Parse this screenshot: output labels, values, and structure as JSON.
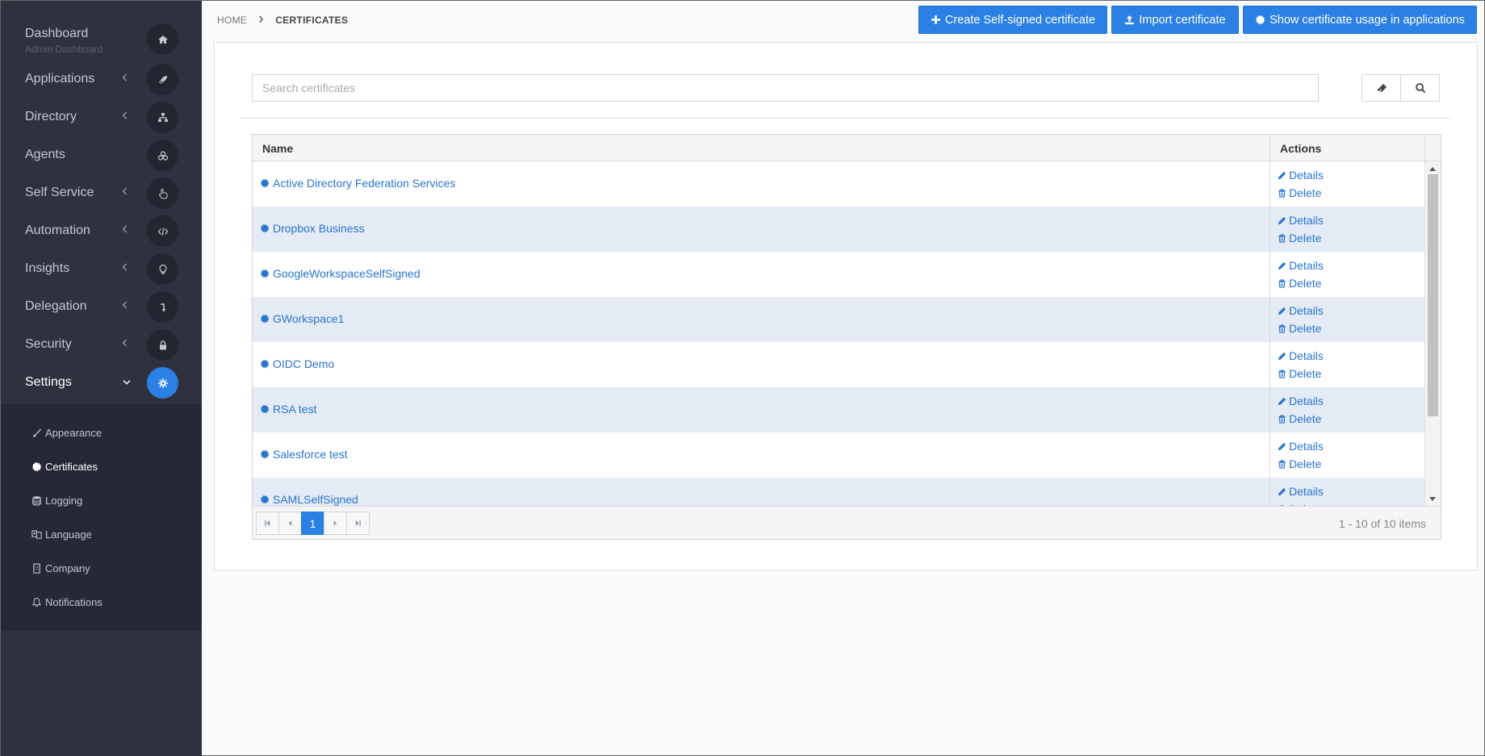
{
  "sidebar": {
    "items": [
      {
        "label": "Dashboard",
        "sub": "Admin Dashboard",
        "icon": "home-icon"
      },
      {
        "label": "Applications",
        "icon": "rocket-icon"
      },
      {
        "label": "Directory",
        "icon": "sitemap-icon"
      },
      {
        "label": "Agents",
        "icon": "cubes-icon"
      },
      {
        "label": "Self Service",
        "icon": "hand-pointer-icon"
      },
      {
        "label": "Automation",
        "icon": "code-icon"
      },
      {
        "label": "Insights",
        "icon": "lightbulb-icon"
      },
      {
        "label": "Delegation",
        "icon": "level-down-icon"
      },
      {
        "label": "Security",
        "icon": "lock-icon"
      },
      {
        "label": "Settings",
        "icon": "gear-icon"
      }
    ],
    "sub_items": [
      {
        "label": "Appearance",
        "icon": "paint-brush-icon"
      },
      {
        "label": "Certificates",
        "icon": "certificate-icon"
      },
      {
        "label": "Logging",
        "icon": "database-icon"
      },
      {
        "label": "Language",
        "icon": "language-icon"
      },
      {
        "label": "Company",
        "icon": "building-icon"
      },
      {
        "label": "Notifications",
        "icon": "bell-icon"
      }
    ]
  },
  "breadcrumb": {
    "home": "HOME",
    "current": "CERTIFICATES"
  },
  "toolbar": {
    "create_label": "Create Self-signed certificate",
    "import_label": "Import certificate",
    "usage_label": "Show certificate usage in applications"
  },
  "search": {
    "placeholder": "Search certificates",
    "value": ""
  },
  "grid": {
    "columns": {
      "name": "Name",
      "actions": "Actions"
    },
    "rows": [
      {
        "name": "Active Directory Federation Services"
      },
      {
        "name": "Dropbox Business"
      },
      {
        "name": "GoogleWorkspaceSelfSigned"
      },
      {
        "name": "GWorkspace1"
      },
      {
        "name": "OIDC Demo"
      },
      {
        "name": "RSA test"
      },
      {
        "name": "Salesforce test"
      },
      {
        "name": "SAMLSelfSigned"
      }
    ],
    "details_label": "Details",
    "delete_label": "Delete"
  },
  "pager": {
    "current_page": "1",
    "info": "1 - 10 of 10 items"
  },
  "colors": {
    "accent": "#2a80e4",
    "sidebar": "#2f323e",
    "link": "#2a75cf",
    "row_alt": "#e4ebf4"
  }
}
